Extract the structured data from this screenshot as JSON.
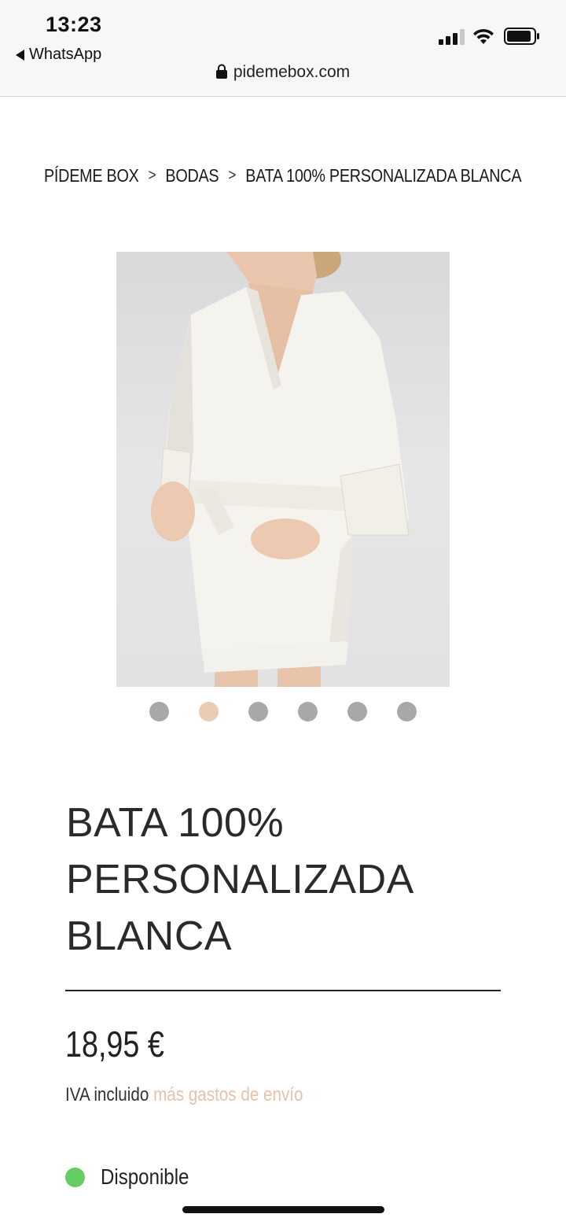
{
  "status_bar": {
    "time": "13:23",
    "back_app": "WhatsApp"
  },
  "browser": {
    "url": "pidemebox.com"
  },
  "breadcrumb": {
    "items": [
      "PÍDEME BOX",
      "BODAS",
      "BATA 100% PERSONALIZADA BLANCA"
    ],
    "separator": ">"
  },
  "gallery": {
    "image_count": 6,
    "active_index": 1,
    "dot_color": "#a8a8a8",
    "active_dot_color": "#eacbb4"
  },
  "product": {
    "title_lines": [
      "BATA 100%",
      "PERSONALIZADA",
      "BLANCA"
    ],
    "price": "18,95 €",
    "tax_text": "IVA incluido",
    "shipping_link": "más gastos de envío",
    "availability": "Disponible",
    "availability_color": "#63cc63",
    "accent_color": "#e7c2aa"
  }
}
